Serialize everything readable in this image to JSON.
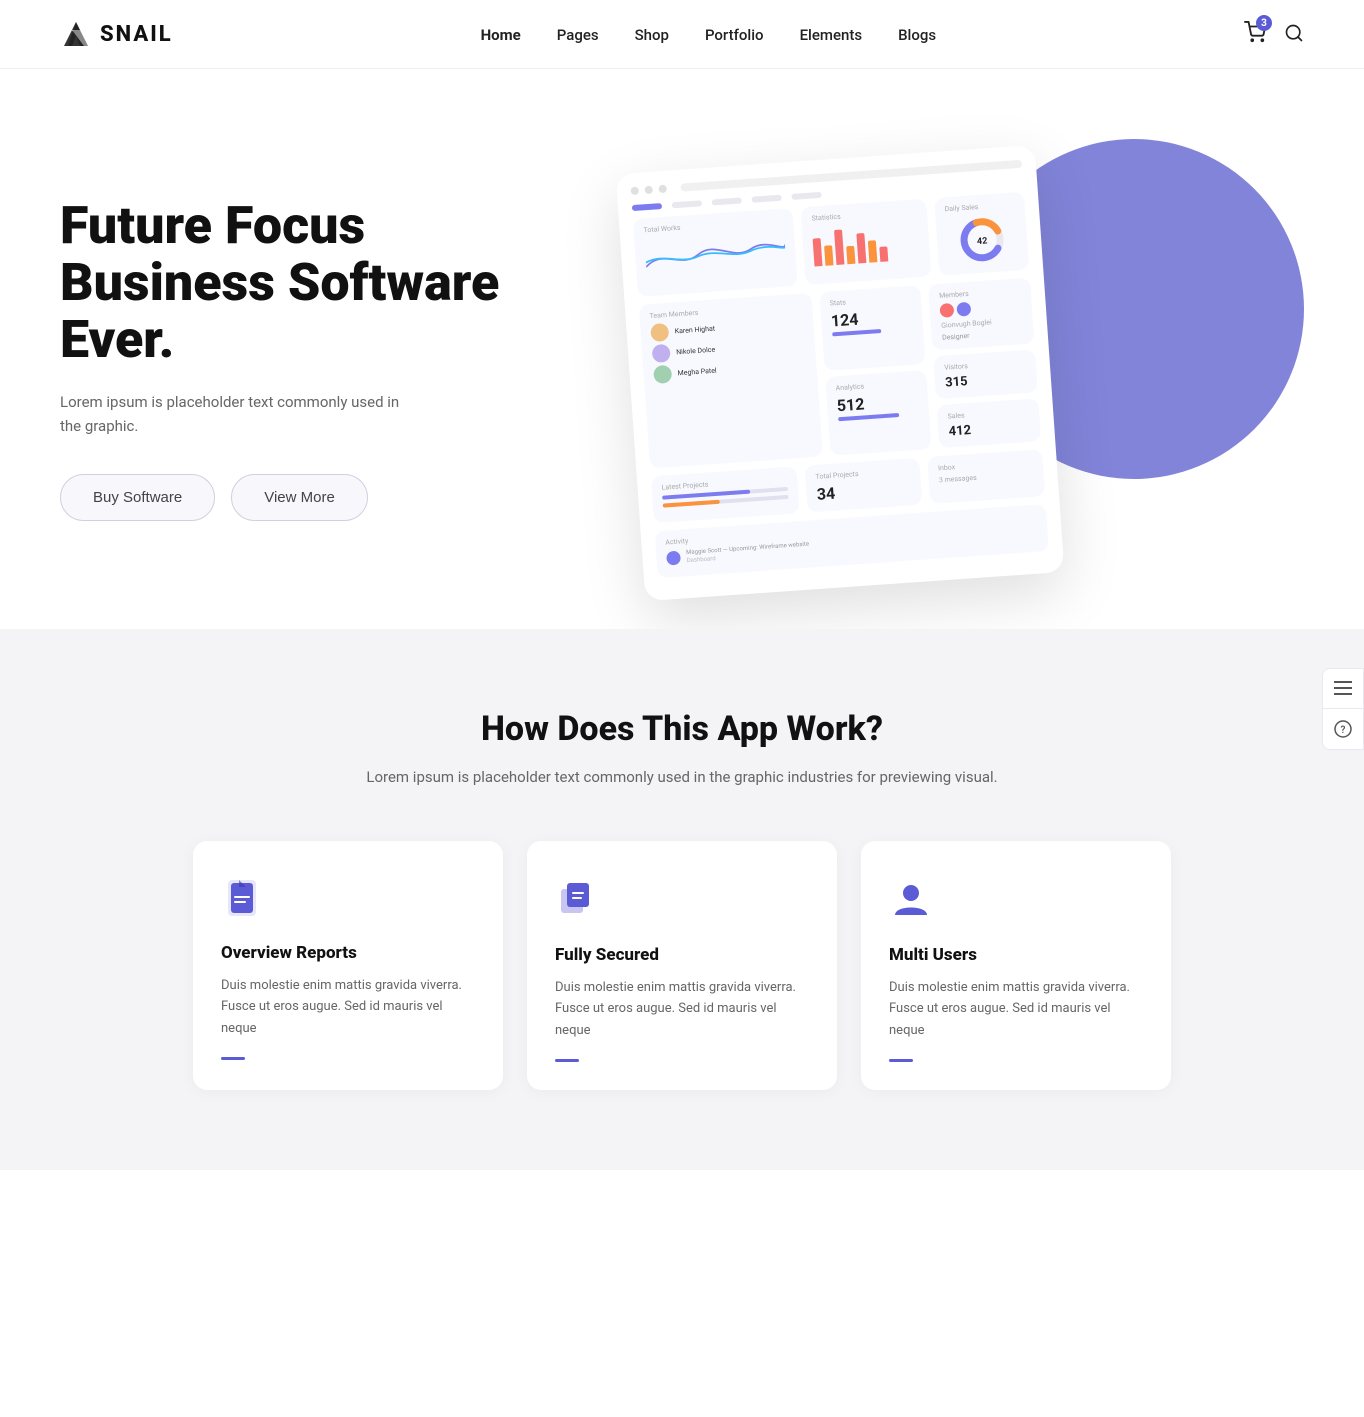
{
  "brand": {
    "name": "SNAIL"
  },
  "nav": {
    "links": [
      {
        "label": "Home",
        "active": true
      },
      {
        "label": "Pages",
        "active": false
      },
      {
        "label": "Shop",
        "active": false
      },
      {
        "label": "Portfolio",
        "active": false
      },
      {
        "label": "Elements",
        "active": false
      },
      {
        "label": "Blogs",
        "active": false
      }
    ],
    "cart_count": "3"
  },
  "hero": {
    "title": "Future Focus Business Software Ever.",
    "subtitle": "Lorem ipsum is placeholder text commonly used in the graphic.",
    "btn_primary": "Buy Software",
    "btn_secondary": "View More"
  },
  "features": {
    "heading": "How Does This App Work?",
    "subtext": "Lorem ipsum is placeholder text commonly used in the graphic industries for previewing visual.",
    "cards": [
      {
        "icon": "file",
        "title": "Overview Reports",
        "desc": "Duis molestie enim mattis gravida viverra. Fusce ut eros augue. Sed id mauris vel neque"
      },
      {
        "icon": "shield",
        "title": "Fully Secured",
        "desc": "Duis molestie enim mattis gravida viverra. Fusce ut eros augue. Sed id mauris vel neque"
      },
      {
        "icon": "user",
        "title": "Multi Users",
        "desc": "Duis molestie enim mattis gravida viverra. Fusce ut eros augue. Sed id mauris vel neque"
      }
    ]
  },
  "sidebar_tools": [
    {
      "icon": "menu",
      "label": "menu-icon"
    },
    {
      "icon": "help",
      "label": "help-icon"
    }
  ],
  "colors": {
    "accent": "#5b5bd6",
    "purple_blob": "#6c6fd4"
  }
}
